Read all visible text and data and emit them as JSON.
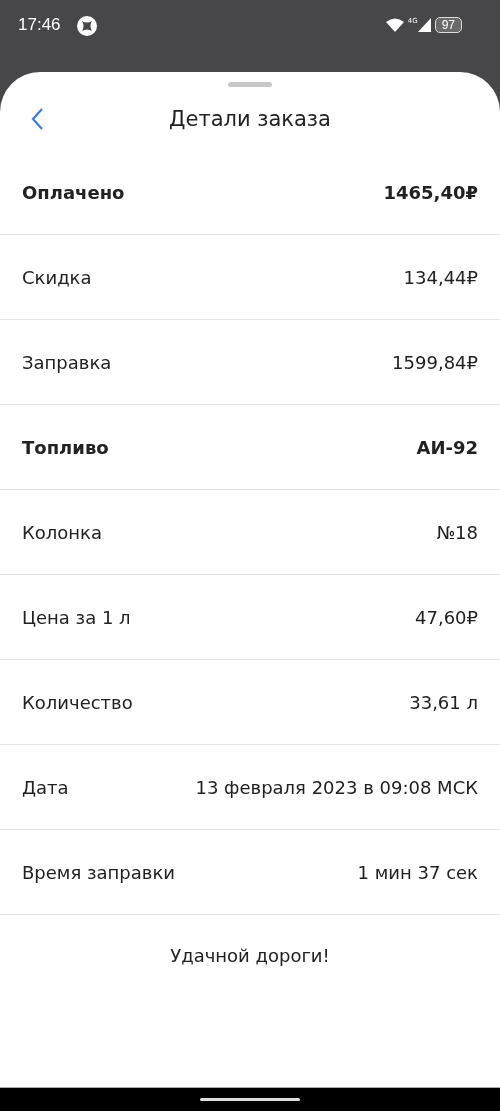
{
  "status_bar": {
    "time": "17:46",
    "network": "4G",
    "battery": "97"
  },
  "header": {
    "title": "Детали заказа"
  },
  "rows": [
    {
      "label": "Оплачено",
      "value": "1465,40₽",
      "kind": "bold"
    },
    {
      "label": "Скидка",
      "value": "134,44₽",
      "kind": "plain"
    },
    {
      "label": "Заправка",
      "value": "1599,84₽",
      "kind": "plain"
    },
    {
      "label": "Топливо",
      "value": "АИ-92",
      "kind": "bold"
    },
    {
      "label": "Колонка",
      "value": "№18",
      "kind": "plain"
    },
    {
      "label": "Цена за 1 л",
      "value": "47,60₽",
      "kind": "plain"
    },
    {
      "label": "Количество",
      "value": "33,61 л",
      "kind": "plain"
    },
    {
      "label": "Дата",
      "value": "13 февраля 2023 в 09:08 МСК",
      "kind": "plain"
    },
    {
      "label": "Время заправки",
      "value": "1 мин 37 сек",
      "kind": "plain"
    }
  ],
  "footer": {
    "message": "Удачной дороги!"
  }
}
